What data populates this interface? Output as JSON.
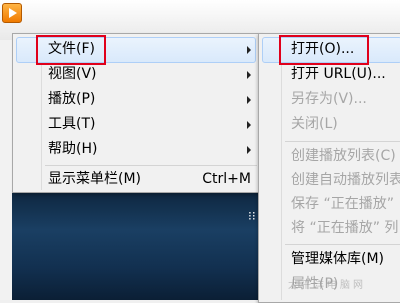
{
  "main_menu": {
    "items": [
      {
        "label": "文件(F)",
        "has_submenu": true
      },
      {
        "label": "视图(V)",
        "has_submenu": true
      },
      {
        "label": "播放(P)",
        "has_submenu": true
      },
      {
        "label": "工具(T)",
        "has_submenu": true
      },
      {
        "label": "帮助(H)",
        "has_submenu": true
      }
    ],
    "show_menubar": {
      "label": "显示菜单栏(M)",
      "shortcut": "Ctrl+M"
    }
  },
  "file_submenu": {
    "items": [
      {
        "label": "打开(O)...",
        "enabled": true
      },
      {
        "label": "打开 URL(U)...",
        "enabled": true
      },
      {
        "label": "另存为(V)...",
        "enabled": false
      },
      {
        "label": "关闭(L)",
        "enabled": false
      },
      {
        "label": "创建播放列表(C)",
        "enabled": false
      },
      {
        "label": "创建自动播放列表",
        "enabled": false
      },
      {
        "label": "保存 “正在播放”",
        "enabled": false
      },
      {
        "label": "将 “正在播放” 列",
        "enabled": false
      },
      {
        "label": "管理媒体库(M)",
        "enabled": true
      },
      {
        "label": "属性(P)",
        "enabled": false
      }
    ]
  },
  "watermark": "太平洋电脑网",
  "colors": {
    "highlight_border": "#e0001b",
    "selection_fill": "#d9e9fb",
    "disabled_text": "#a6a6a6"
  }
}
